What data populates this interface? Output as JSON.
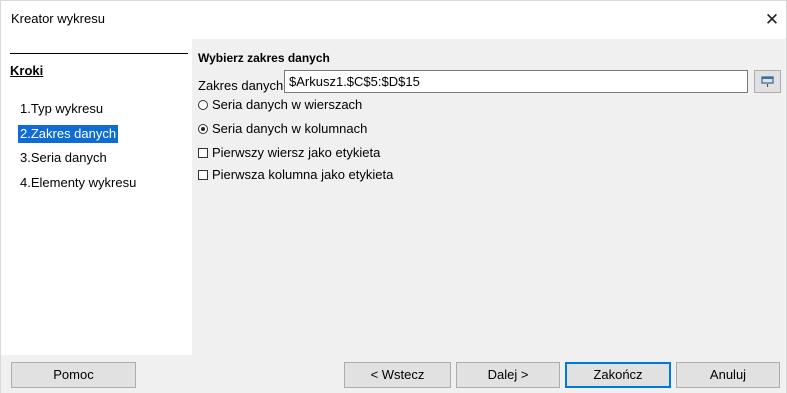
{
  "window": {
    "title": "Kreator wykresu",
    "close_glyph": "✕"
  },
  "sidebar": {
    "title": "Kroki",
    "steps": [
      {
        "label": "1.Typ wykresu"
      },
      {
        "label": "2.Zakres danych"
      },
      {
        "label": "3.Seria danych"
      },
      {
        "label": "4.Elementy wykresu"
      }
    ],
    "selected_step": "2.Zakres danych"
  },
  "main": {
    "section_title": "Wybierz zakres danych",
    "range_label": "Zakres danych:",
    "range_value": "$Arkusz1.$C$5:$D$15",
    "radio_rows": "Seria danych w wierszach",
    "radio_cols": "Seria danych w kolumnach",
    "radio_selected": "Seria danych w kolumnach",
    "check_first_row": "Pierwszy wiersz jako etykieta",
    "check_first_col": "Pierwsza kolumna jako etykieta",
    "shrink_icon": "shrink-icon"
  },
  "footer": {
    "help": "Pomoc",
    "back": "< Wstecz",
    "next": "Dalej >",
    "finish": "Zakończ",
    "cancel": "Anuluj"
  },
  "colors": {
    "accent": "#0f6cd1",
    "dialog_bg": "#f0f0f0",
    "button_bg": "#e1e1e1",
    "default_border": "#0078d7"
  }
}
